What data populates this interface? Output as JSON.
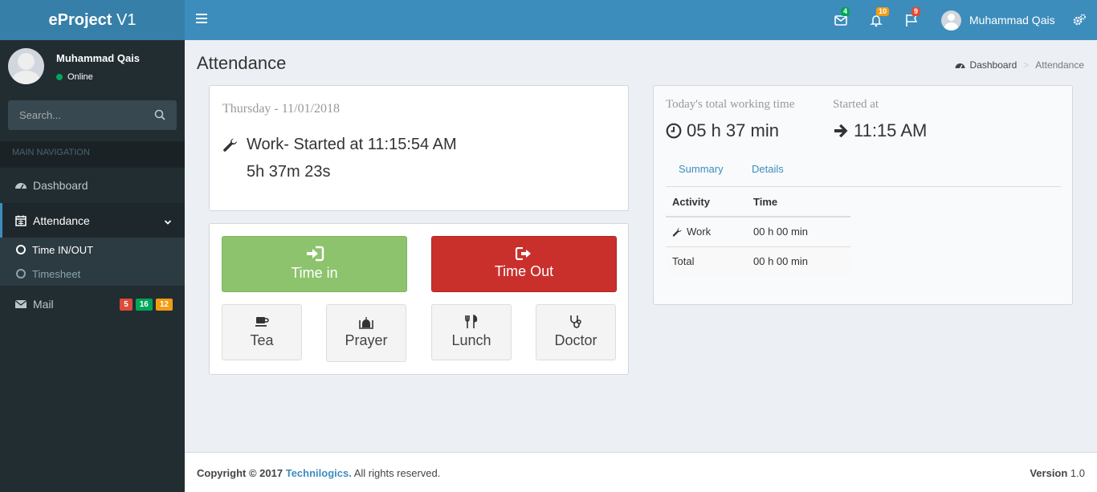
{
  "app": {
    "logo_bold": "eProject",
    "logo_rest": " V1"
  },
  "header": {
    "mail_count": "4",
    "notifications_count": "10",
    "tasks_count": "9",
    "user_name": "Muhammad Qais",
    "colors": {
      "mail_badge": "#00a65a",
      "notif_badge": "#f39c12",
      "tasks_badge": "#dd4b39"
    }
  },
  "sidebar": {
    "user_name": "Muhammad Qais",
    "status": "Online",
    "search_placeholder": "Search...",
    "section_header": "MAIN NAVIGATION",
    "items": {
      "dashboard": "Dashboard",
      "attendance": "Attendance",
      "time_in_out": "Time IN/OUT",
      "timesheet": "Timesheet",
      "mail": "Mail"
    },
    "mail_labels": [
      "5",
      "16",
      "12"
    ]
  },
  "page": {
    "title": "Attendance",
    "breadcrumb": {
      "home": "Dashboard",
      "current": "Attendance"
    }
  },
  "status_box": {
    "date": "Thursday - 11/01/2018",
    "work_status": "Work- Started at 11:15:54 AM",
    "elapsed": "5h 37m 23s"
  },
  "actions": {
    "time_in": "Time in",
    "time_out": "Time Out",
    "tea": "Tea",
    "prayer": "Prayer",
    "lunch": "Lunch",
    "doctor": "Doctor",
    "colors": {
      "time_in": "#8cc36c",
      "time_out": "#c9302c"
    }
  },
  "summary": {
    "total_label": "Today's total working time",
    "total_value": "05 h 37 min",
    "started_label": "Started at",
    "started_value": "11:15 AM",
    "tabs": [
      "Summary",
      "Details"
    ],
    "table": {
      "headers": [
        "Activity",
        "Time"
      ],
      "rows": [
        {
          "activity": "Work",
          "time": "00 h 00 min"
        }
      ],
      "total": {
        "label": "Total",
        "time": "00 h 00 min"
      }
    }
  },
  "footer": {
    "copyright": "Copyright © 2017 ",
    "company": "Technilogics.",
    "rights": " All rights reserved.",
    "version_label": "Version",
    "version": " 1.0"
  }
}
